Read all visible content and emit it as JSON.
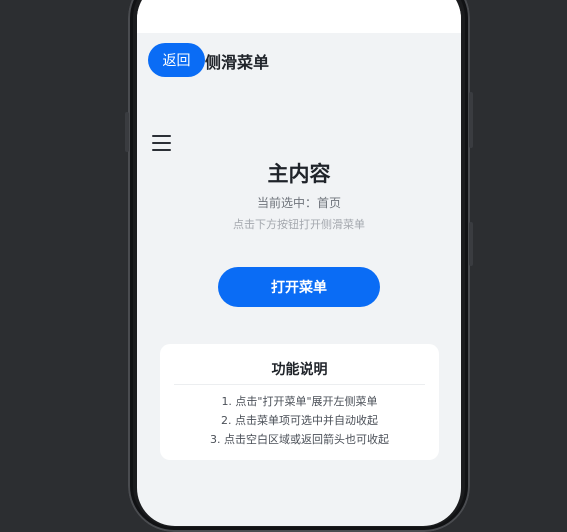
{
  "header": {
    "back_label": "返回",
    "title": "侧滑菜单"
  },
  "main": {
    "title": "主内容",
    "current_selection": "当前选中：首页",
    "hint": "点击下方按钮打开侧滑菜单",
    "open_menu_label": "打开菜单"
  },
  "info_card": {
    "title": "功能说明",
    "items": [
      "1. 点击\"打开菜单\"展开左侧菜单",
      "2. 点击菜单项可选中并自动收起",
      "3. 点击空白区域或返回箭头也可收起"
    ]
  },
  "colors": {
    "accent": "#0a6cf5",
    "background": "#f1f3f5",
    "card": "#ffffff",
    "text_primary": "#1f2329"
  },
  "icons": {
    "menu": "hamburger-menu-icon"
  }
}
